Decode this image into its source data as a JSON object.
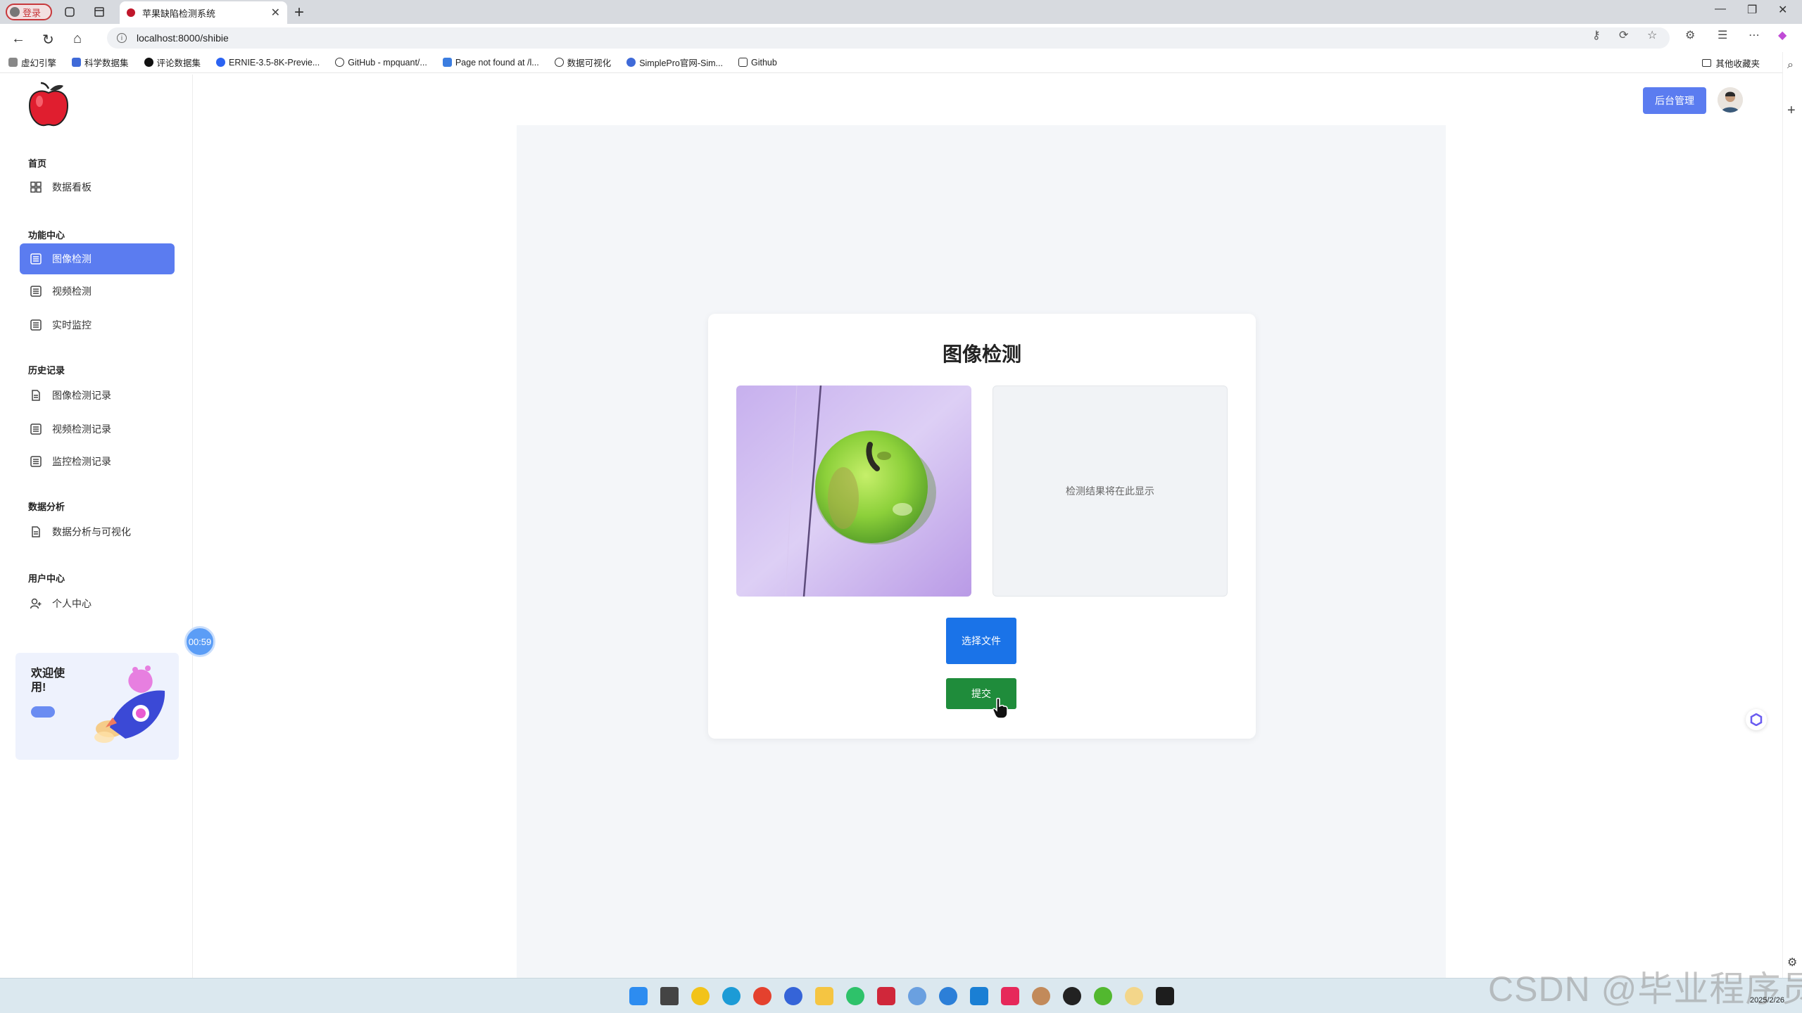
{
  "browser": {
    "profile_label": "登录",
    "tab_title": "苹果缺陷检测系统",
    "url": "localhost:8000/shibie",
    "bookmarks": [
      {
        "label": "虚幻引擎"
      },
      {
        "label": "科学数据集"
      },
      {
        "label": "评论数据集"
      },
      {
        "label": "ERNIE-3.5-8K-Previe..."
      },
      {
        "label": "GitHub - mpquant/..."
      },
      {
        "label": "Page not found at /l..."
      },
      {
        "label": "数据可视化"
      },
      {
        "label": "SimplePro官网-Sim..."
      },
      {
        "label": "Github"
      }
    ],
    "other_bookmarks": "其他收藏夹"
  },
  "sidebar": {
    "sections": [
      {
        "title": "首页",
        "items": [
          {
            "label": "数据看板"
          }
        ]
      },
      {
        "title": "功能中心",
        "items": [
          {
            "label": "图像检测"
          },
          {
            "label": "视频检测"
          },
          {
            "label": "实时监控"
          }
        ]
      },
      {
        "title": "历史记录",
        "items": [
          {
            "label": "图像检测记录"
          },
          {
            "label": "视频检测记录"
          },
          {
            "label": "监控检测记录"
          }
        ]
      },
      {
        "title": "数据分析",
        "items": [
          {
            "label": "数据分析与可视化"
          }
        ]
      },
      {
        "title": "用户中心",
        "items": [
          {
            "label": "个人中心"
          }
        ]
      }
    ],
    "active_item": "图像检测",
    "welcome_text": "欢迎使用!",
    "timer": "00:59"
  },
  "header": {
    "admin_button": "后台管理"
  },
  "main": {
    "title": "图像检测",
    "result_placeholder": "检测结果将在此显示",
    "choose_button": "选择文件",
    "submit_button": "提交"
  },
  "taskbar": {
    "watermark": "CSDN @毕业程序员",
    "date": "2025/2/26"
  },
  "colors": {
    "accent": "#5b7cf0",
    "primary_button": "#1a73e8",
    "submit_button": "#1f8c3b",
    "main_background": "#f4f6f9"
  }
}
